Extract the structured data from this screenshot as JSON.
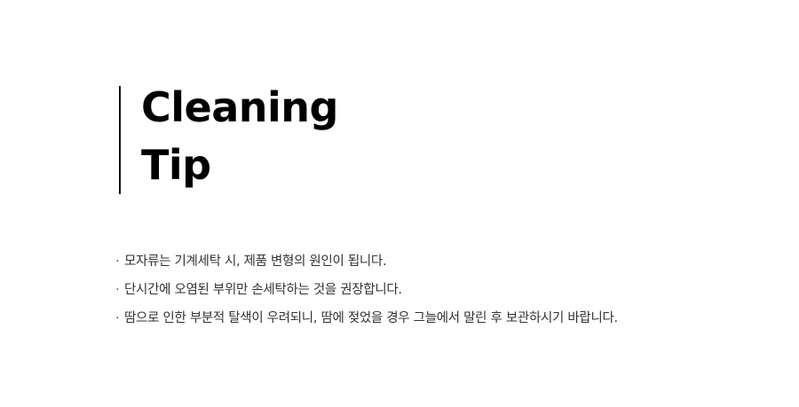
{
  "title": {
    "line1": "Cleaning",
    "line2": "Tip"
  },
  "tips": [
    {
      "bullet": "·",
      "text": "모자류는 기계세탁 시, 제품 변형의 원인이 됩니다."
    },
    {
      "bullet": "·",
      "text": "단시간에 오염된 부위만 손세탁하는 것을 권장합니다."
    },
    {
      "bullet": "·",
      "text": "땀으로 인한 부분적 탈색이 우려되니, 땀에 젖었을 경우 그늘에서 말린 후 보관하시기 바랍니다."
    }
  ]
}
